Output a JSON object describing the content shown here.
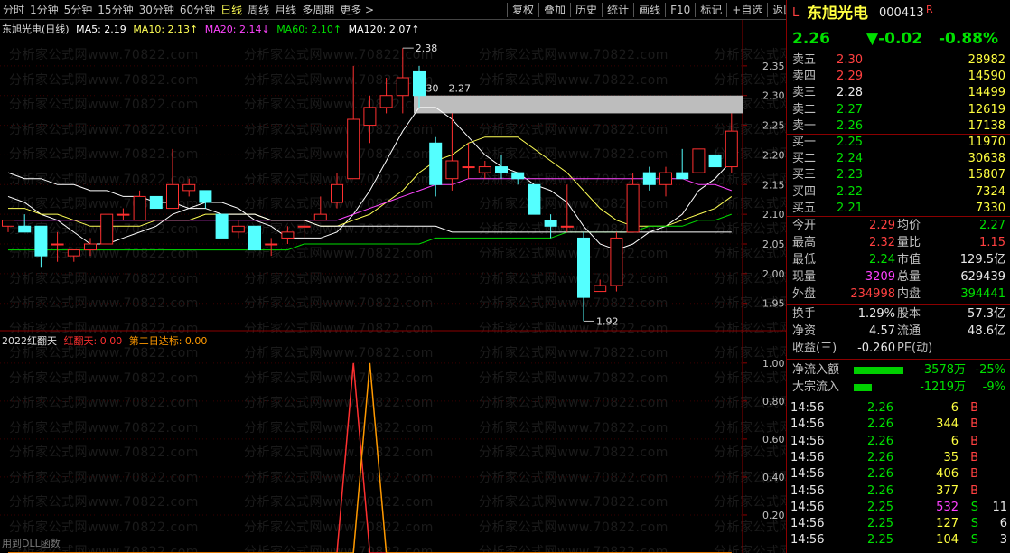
{
  "toolbar": {
    "periods": [
      "分时",
      "1分钟",
      "5分钟",
      "15分钟",
      "30分钟",
      "60分钟",
      "日线",
      "周线",
      "月线",
      "多周期",
      "更多 >"
    ],
    "active_period": "日线",
    "tools": [
      "复权",
      "叠加",
      "历史",
      "统计",
      "画线",
      "F10",
      "标记",
      "+自选",
      "返回"
    ]
  },
  "main_legend": {
    "title": "东旭光电(日线)",
    "ma5": "MA5: 2.19",
    "ma10": "MA10: 2.13↑",
    "ma20": "MA20: 2.14↓",
    "ma60": "MA60: 2.10↑",
    "ma120": "MA120: 2.07↑"
  },
  "indicator_legend": {
    "name": "2022红翻天",
    "hft": "红翻天: 0.00",
    "second": "第二日达标: 0.00"
  },
  "bottom_text": "用到DLL函数",
  "watermark_text": "分析家公式网www.70822.com",
  "chart_data": [
    {
      "type": "candlestick",
      "title": "东旭光电(日线)",
      "y_ticks": [
        1.95,
        2.0,
        2.05,
        2.1,
        2.15,
        2.2,
        2.25,
        2.3,
        2.35
      ],
      "ylim": [
        1.91,
        2.4
      ],
      "annotations": {
        "high": "2.38",
        "low": "1.92",
        "box": "2.30 - 2.27"
      },
      "candles": [
        {
          "o": 2.08,
          "h": 2.09,
          "l": 2.07,
          "c": 2.09
        },
        {
          "o": 2.08,
          "h": 2.1,
          "l": 2.07,
          "c": 2.07
        },
        {
          "o": 2.08,
          "h": 2.08,
          "l": 2.01,
          "c": 2.03
        },
        {
          "o": 2.05,
          "h": 2.07,
          "l": 2.02,
          "c": 2.05
        },
        {
          "o": 2.03,
          "h": 2.04,
          "l": 2.02,
          "c": 2.04
        },
        {
          "o": 2.04,
          "h": 2.06,
          "l": 2.03,
          "c": 2.05
        },
        {
          "o": 2.05,
          "h": 2.1,
          "l": 2.05,
          "c": 2.1
        },
        {
          "o": 2.1,
          "h": 2.11,
          "l": 2.09,
          "c": 2.1
        },
        {
          "o": 2.09,
          "h": 2.14,
          "l": 2.09,
          "c": 2.13
        },
        {
          "o": 2.13,
          "h": 2.13,
          "l": 2.11,
          "c": 2.11
        },
        {
          "o": 2.11,
          "h": 2.21,
          "l": 2.11,
          "c": 2.15
        },
        {
          "o": 2.14,
          "h": 2.16,
          "l": 2.13,
          "c": 2.15
        },
        {
          "o": 2.14,
          "h": 2.14,
          "l": 2.11,
          "c": 2.12
        },
        {
          "o": 2.1,
          "h": 2.1,
          "l": 2.06,
          "c": 2.06
        },
        {
          "o": 2.07,
          "h": 2.09,
          "l": 2.06,
          "c": 2.08
        },
        {
          "o": 2.08,
          "h": 2.08,
          "l": 2.04,
          "c": 2.04
        },
        {
          "o": 2.05,
          "h": 2.06,
          "l": 2.03,
          "c": 2.05
        },
        {
          "o": 2.06,
          "h": 2.08,
          "l": 2.05,
          "c": 2.07
        },
        {
          "o": 2.08,
          "h": 2.09,
          "l": 2.06,
          "c": 2.08
        },
        {
          "o": 2.09,
          "h": 2.13,
          "l": 2.09,
          "c": 2.1
        },
        {
          "o": 2.12,
          "h": 2.17,
          "l": 2.11,
          "c": 2.15
        },
        {
          "o": 2.16,
          "h": 2.35,
          "l": 2.16,
          "c": 2.26
        },
        {
          "o": 2.25,
          "h": 2.3,
          "l": 2.22,
          "c": 2.28
        },
        {
          "o": 2.28,
          "h": 2.33,
          "l": 2.27,
          "c": 2.3
        },
        {
          "o": 2.3,
          "h": 2.38,
          "l": 2.27,
          "c": 2.33
        },
        {
          "o": 2.34,
          "h": 2.35,
          "l": 2.28,
          "c": 2.3
        },
        {
          "o": 2.22,
          "h": 2.23,
          "l": 2.13,
          "c": 2.15
        },
        {
          "o": 2.16,
          "h": 2.27,
          "l": 2.14,
          "c": 2.19
        },
        {
          "o": 2.18,
          "h": 2.22,
          "l": 2.16,
          "c": 2.18
        },
        {
          "o": 2.17,
          "h": 2.19,
          "l": 2.16,
          "c": 2.18
        },
        {
          "o": 2.18,
          "h": 2.2,
          "l": 2.16,
          "c": 2.17
        },
        {
          "o": 2.17,
          "h": 2.17,
          "l": 2.15,
          "c": 2.16
        },
        {
          "o": 2.15,
          "h": 2.15,
          "l": 2.1,
          "c": 2.1
        },
        {
          "o": 2.09,
          "h": 2.1,
          "l": 2.06,
          "c": 2.08
        },
        {
          "o": 2.08,
          "h": 2.15,
          "l": 2.07,
          "c": 2.08
        },
        {
          "o": 2.06,
          "h": 2.07,
          "l": 1.92,
          "c": 1.96
        },
        {
          "o": 1.97,
          "h": 1.99,
          "l": 1.97,
          "c": 1.98
        },
        {
          "o": 1.98,
          "h": 2.07,
          "l": 1.97,
          "c": 2.06
        },
        {
          "o": 2.07,
          "h": 2.17,
          "l": 2.07,
          "c": 2.15
        },
        {
          "o": 2.17,
          "h": 2.18,
          "l": 2.14,
          "c": 2.15
        },
        {
          "o": 2.15,
          "h": 2.18,
          "l": 2.13,
          "c": 2.17
        },
        {
          "o": 2.17,
          "h": 2.21,
          "l": 2.16,
          "c": 2.16
        },
        {
          "o": 2.17,
          "h": 2.21,
          "l": 2.17,
          "c": 2.21
        },
        {
          "o": 2.2,
          "h": 2.21,
          "l": 2.18,
          "c": 2.18
        },
        {
          "o": 2.18,
          "h": 2.27,
          "l": 2.17,
          "c": 2.24
        }
      ],
      "ma_series": [
        {
          "name": "MA5",
          "color": "#ffffff",
          "values": [
            2.13,
            2.12,
            2.1,
            2.09,
            2.07,
            2.05,
            2.05,
            2.06,
            2.07,
            2.08,
            2.1,
            2.11,
            2.12,
            2.12,
            2.11,
            2.09,
            2.08,
            2.06,
            2.06,
            2.06,
            2.07,
            2.1,
            2.14,
            2.19,
            2.24,
            2.28,
            2.28,
            2.26,
            2.23,
            2.2,
            2.18,
            2.17,
            2.15,
            2.14,
            2.12,
            2.08,
            2.05,
            2.04,
            2.05,
            2.07,
            2.08,
            2.1,
            2.14,
            2.16,
            2.19
          ]
        },
        {
          "name": "MA10",
          "color": "#ffff55",
          "values": [
            2.11,
            2.11,
            2.1,
            2.1,
            2.09,
            2.08,
            2.08,
            2.08,
            2.08,
            2.09,
            2.09,
            2.09,
            2.1,
            2.1,
            2.1,
            2.1,
            2.09,
            2.09,
            2.09,
            2.08,
            2.08,
            2.09,
            2.1,
            2.12,
            2.14,
            2.17,
            2.19,
            2.2,
            2.22,
            2.23,
            2.23,
            2.23,
            2.21,
            2.19,
            2.17,
            2.14,
            2.11,
            2.09,
            2.08,
            2.08,
            2.08,
            2.09,
            2.1,
            2.11,
            2.13
          ]
        },
        {
          "name": "MA20",
          "color": "#ff44ff",
          "values": [
            2.09,
            2.09,
            2.09,
            2.09,
            2.09,
            2.09,
            2.09,
            2.09,
            2.09,
            2.09,
            2.09,
            2.09,
            2.09,
            2.09,
            2.09,
            2.09,
            2.09,
            2.09,
            2.09,
            2.09,
            2.09,
            2.1,
            2.11,
            2.12,
            2.13,
            2.14,
            2.15,
            2.15,
            2.16,
            2.16,
            2.16,
            2.16,
            2.16,
            2.16,
            2.16,
            2.16,
            2.16,
            2.16,
            2.16,
            2.16,
            2.16,
            2.16,
            2.15,
            2.15,
            2.14
          ]
        },
        {
          "name": "MA60",
          "color": "#00dd00",
          "values": [
            2.04,
            2.04,
            2.04,
            2.04,
            2.04,
            2.04,
            2.04,
            2.04,
            2.04,
            2.04,
            2.04,
            2.04,
            2.04,
            2.04,
            2.04,
            2.04,
            2.04,
            2.04,
            2.05,
            2.05,
            2.05,
            2.05,
            2.05,
            2.05,
            2.05,
            2.05,
            2.06,
            2.06,
            2.06,
            2.06,
            2.06,
            2.06,
            2.06,
            2.06,
            2.07,
            2.07,
            2.07,
            2.07,
            2.07,
            2.08,
            2.08,
            2.08,
            2.09,
            2.09,
            2.1
          ]
        },
        {
          "name": "MA120",
          "color": "#ffffff",
          "values": [
            2.17,
            2.16,
            2.16,
            2.15,
            2.15,
            2.14,
            2.14,
            2.13,
            2.13,
            2.12,
            2.12,
            2.11,
            2.11,
            2.1,
            2.1,
            2.1,
            2.09,
            2.09,
            2.09,
            2.08,
            2.08,
            2.08,
            2.08,
            2.08,
            2.08,
            2.08,
            2.08,
            2.07,
            2.07,
            2.07,
            2.07,
            2.07,
            2.07,
            2.07,
            2.07,
            2.07,
            2.07,
            2.07,
            2.07,
            2.07,
            2.07,
            2.07,
            2.07,
            2.07,
            2.07
          ]
        }
      ]
    },
    {
      "type": "line",
      "title": "2022红翻天",
      "y_ticks": [
        0.0,
        0.2,
        0.4,
        0.6,
        0.8,
        1.0
      ],
      "ylim": [
        0,
        1.08
      ],
      "series": [
        {
          "name": "红翻天",
          "color": "#ff3030",
          "values": [
            0,
            0,
            0,
            0,
            0,
            0,
            0,
            0,
            0,
            0,
            0,
            0,
            0,
            0,
            0,
            0,
            0,
            0,
            0,
            0,
            0,
            1,
            0,
            0,
            0,
            0,
            0,
            0,
            0,
            0,
            0,
            0,
            0,
            0,
            0,
            0,
            0,
            0,
            0,
            0,
            0,
            0,
            0,
            0,
            0
          ]
        },
        {
          "name": "第二日达标",
          "color": "#ff9900",
          "values": [
            0,
            0,
            0,
            0,
            0,
            0,
            0,
            0,
            0,
            0,
            0,
            0,
            0,
            0,
            0,
            0,
            0,
            0,
            0,
            0,
            0,
            0,
            1,
            0,
            0,
            0,
            0,
            0,
            0,
            0,
            0,
            0,
            0,
            0,
            0,
            0,
            0,
            0,
            0,
            0,
            0,
            0,
            0,
            0,
            0
          ]
        }
      ]
    }
  ],
  "quote": {
    "code_prefix": "L",
    "name": "东旭光电",
    "code": "000413",
    "flag": "R",
    "price": "2.26",
    "change": "▼-0.02",
    "pct": "-0.88%",
    "asks": [
      {
        "label": "卖五",
        "price": "2.30",
        "vol": "28982",
        "pcolor": "red"
      },
      {
        "label": "卖四",
        "price": "2.29",
        "vol": "14590",
        "pcolor": "red"
      },
      {
        "label": "卖三",
        "price": "2.28",
        "vol": "14499",
        "pcolor": "wht"
      },
      {
        "label": "卖二",
        "price": "2.27",
        "vol": "12619",
        "pcolor": "grn"
      },
      {
        "label": "卖一",
        "price": "2.26",
        "vol": "17138",
        "pcolor": "grn"
      }
    ],
    "bids": [
      {
        "label": "买一",
        "price": "2.25",
        "vol": "11970",
        "pcolor": "grn"
      },
      {
        "label": "买二",
        "price": "2.24",
        "vol": "30638",
        "pcolor": "grn"
      },
      {
        "label": "买三",
        "price": "2.23",
        "vol": "15807",
        "pcolor": "grn"
      },
      {
        "label": "买四",
        "price": "2.22",
        "vol": "7324",
        "pcolor": "grn"
      },
      {
        "label": "买五",
        "price": "2.21",
        "vol": "7330",
        "pcolor": "grn"
      }
    ],
    "stats": [
      {
        "l1": "今开",
        "v1": "2.29",
        "c1": "red",
        "l2": "均价",
        "v2": "2.27",
        "c2": "grn"
      },
      {
        "l1": "最高",
        "v1": "2.32",
        "c1": "red",
        "l2": "量比",
        "v2": "1.15",
        "c2": "red"
      },
      {
        "l1": "最低",
        "v1": "2.24",
        "c1": "grn",
        "l2": "市值",
        "v2": "129.5亿",
        "c2": "wht"
      },
      {
        "l1": "现量",
        "v1": "3209",
        "c1": "mag",
        "l2": "总量",
        "v2": "629439",
        "c2": "wht"
      },
      {
        "l1": "外盘",
        "v1": "234998",
        "c1": "red",
        "l2": "内盘",
        "v2": "394441",
        "c2": "grn"
      }
    ],
    "stats2": [
      {
        "l1": "换手",
        "v1": "1.29%",
        "l2": "股本",
        "v2": "57.3亿"
      },
      {
        "l1": "净资",
        "v1": "4.57",
        "l2": "流通",
        "v2": "48.6亿"
      },
      {
        "l1": "收益(三)",
        "v1": "-0.260",
        "l2": "PE(动)",
        "v2": ""
      }
    ],
    "flows": [
      {
        "label": "净流入额",
        "amount": "-3578万",
        "pct": "-25%",
        "bar": 0.25
      },
      {
        "label": "大宗流入",
        "amount": "-1219万",
        "pct": "-9%",
        "bar": 0.09
      }
    ],
    "ticks": [
      {
        "time": "14:56",
        "price": "2.26",
        "vol": "6",
        "side": "B",
        "vcolor": "yel",
        "pcolor": "grn"
      },
      {
        "time": "14:56",
        "price": "2.26",
        "vol": "344",
        "side": "B",
        "vcolor": "yel",
        "pcolor": "grn"
      },
      {
        "time": "14:56",
        "price": "2.26",
        "vol": "6",
        "side": "B",
        "vcolor": "yel",
        "pcolor": "grn"
      },
      {
        "time": "14:56",
        "price": "2.26",
        "vol": "35",
        "side": "B",
        "vcolor": "yel",
        "pcolor": "grn"
      },
      {
        "time": "14:56",
        "price": "2.26",
        "vol": "406",
        "side": "B",
        "vcolor": "yel",
        "pcolor": "grn"
      },
      {
        "time": "14:56",
        "price": "2.26",
        "vol": "377",
        "side": "B",
        "vcolor": "yel",
        "pcolor": "grn"
      },
      {
        "time": "14:56",
        "price": "2.25",
        "vol": "532",
        "side": "S",
        "vcolor": "mag",
        "pcolor": "grn",
        "extra": "11"
      },
      {
        "time": "14:56",
        "price": "2.25",
        "vol": "127",
        "side": "S",
        "vcolor": "yel",
        "pcolor": "grn",
        "extra": "6"
      },
      {
        "time": "14:56",
        "price": "2.25",
        "vol": "104",
        "side": "S",
        "vcolor": "yel",
        "pcolor": "grn",
        "extra": "3"
      }
    ]
  }
}
